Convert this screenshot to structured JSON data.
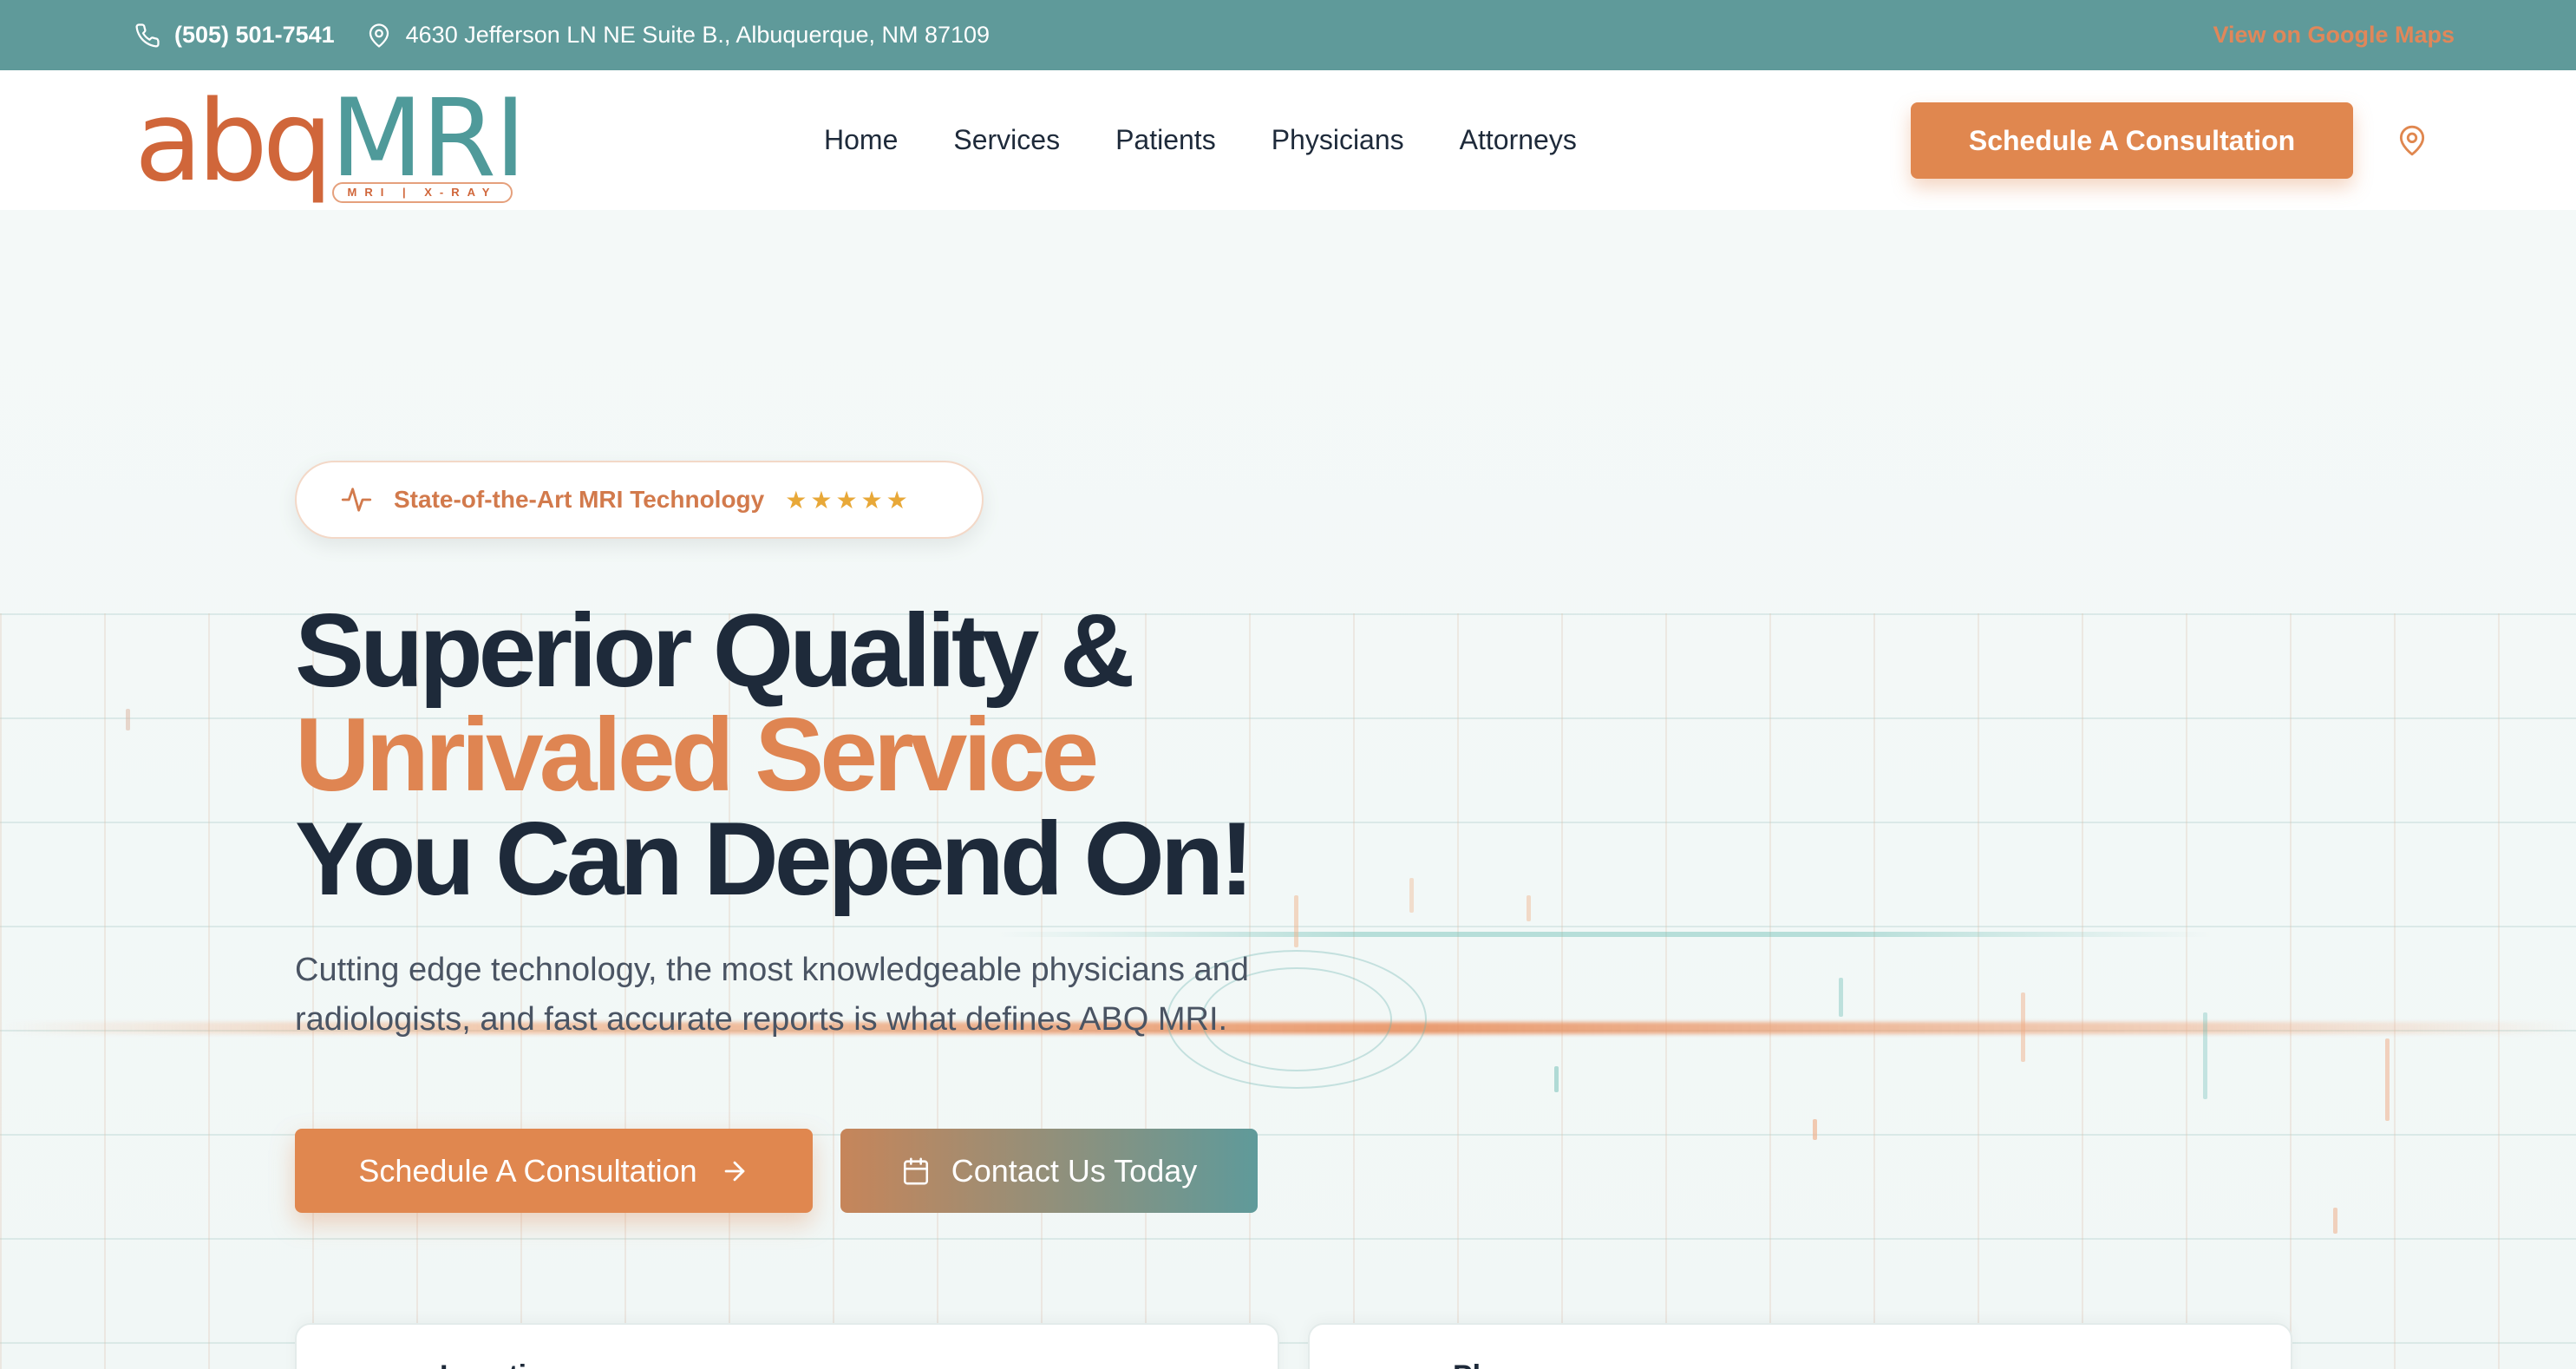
{
  "topbar": {
    "phone": "(505) 501-7541",
    "address": "4630 Jefferson LN NE Suite B., Albuquerque, NM 87109",
    "maps_link": "View on Google Maps"
  },
  "logo": {
    "abq": "abq",
    "mri": "MRI",
    "sub": "MRI | X-RAY"
  },
  "nav": {
    "items": [
      "Home",
      "Services",
      "Patients",
      "Physicians",
      "Attorneys"
    ]
  },
  "header": {
    "cta": "Schedule A Consultation"
  },
  "hero": {
    "badge": "State-of-the-Art MRI Technology",
    "stars": "★★★★★",
    "headline_1": "Superior Quality &",
    "headline_2": "Unrivaled Service",
    "headline_3": "You Can Depend On!",
    "subtext": "Cutting edge technology, the most knowledgeable physicians and radiologists, and fast accurate reports is what defines ABQ MRI.",
    "btn_primary": "Schedule A Consultation",
    "btn_secondary": "Contact Us Today"
  },
  "cards": {
    "card_1": "Location",
    "card_2": "Phone"
  },
  "colors": {
    "teal": "#5f9a9a",
    "orange": "#e0874f",
    "dark": "#1e2a3a"
  }
}
